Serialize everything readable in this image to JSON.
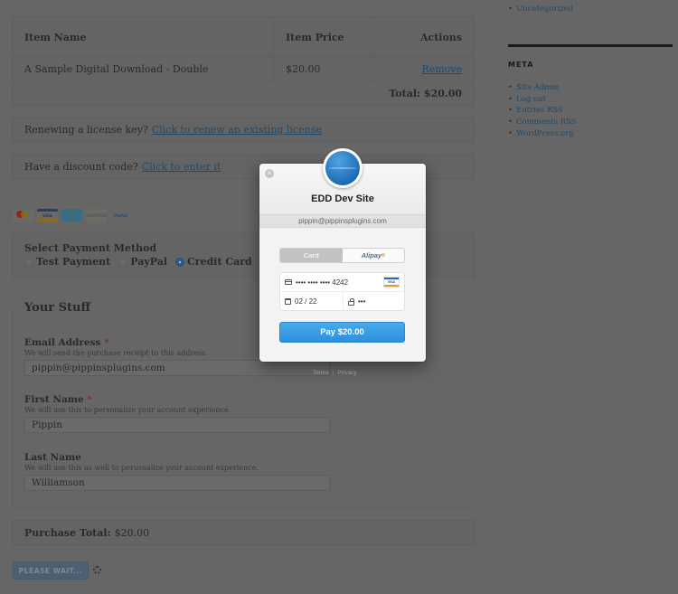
{
  "cart": {
    "headers": {
      "item_name": "Item Name",
      "item_price": "Item Price",
      "actions": "Actions"
    },
    "items": [
      {
        "name": "A Sample Digital Download - Double",
        "price": "$20.00",
        "action": "Remove"
      }
    ],
    "total": "Total: $20.00"
  },
  "renew": {
    "question": "Renewing a license key?",
    "link": "Click to renew an existing license"
  },
  "discount": {
    "question": "Have a discount code?",
    "link": "Click to enter it"
  },
  "accepted_cards": [
    "mastercard-icon",
    "visa-icon",
    "amex-icon",
    "discover-icon",
    "paypal-icon"
  ],
  "card_labels": {
    "visa": "VISA",
    "amex": "AMERICAN EXPRESS",
    "discover": "DISCOVER",
    "paypal": "PayPal"
  },
  "payment_method": {
    "label": "Select Payment Method",
    "options": [
      "Test Payment",
      "PayPal",
      "Credit Card"
    ],
    "selected": "Credit Card"
  },
  "your_stuff": {
    "title": "Your Stuff",
    "email": {
      "label": "Email Address",
      "required": "*",
      "description": "We will send the purchase receipt to this address.",
      "value": "pippin@pippinsplugins.com"
    },
    "first_name": {
      "label": "First Name",
      "required": "*",
      "description": "We will use this to personalize your account experience.",
      "value": "Pippin"
    },
    "last_name": {
      "label": "Last Name",
      "description": "We will use this as well to personalize your account experience.",
      "value": "Williamson"
    }
  },
  "purchase_total": {
    "label": "Purchase Total:",
    "value": "$20.00"
  },
  "submit_button": "PLEASE WAIT...",
  "sidebar": {
    "categories": [
      "Uncategorized"
    ],
    "meta_title": "META",
    "meta_links": [
      "Site Admin",
      "Log out",
      "Entries RSS",
      "Comments RSS",
      "WordPress.org"
    ]
  },
  "modal": {
    "site_name": "EDD Dev Site",
    "email": "pippin@pippinsplugins.com",
    "tabs": {
      "card": "Card",
      "alipay": "Alipay",
      "alipay_sup": "®"
    },
    "active_tab": "Card",
    "card_number": "•••• •••• •••• 4242",
    "card_brand": "VISA",
    "expiry": "02 / 22",
    "cvc": "•••",
    "pay_button": "Pay $20.00",
    "close": "×",
    "footer": {
      "terms": "Terms",
      "separator": "|",
      "privacy": "Privacy"
    },
    "colors": {
      "pay_button": "#3a9ee4",
      "overlay": "#666666"
    }
  }
}
